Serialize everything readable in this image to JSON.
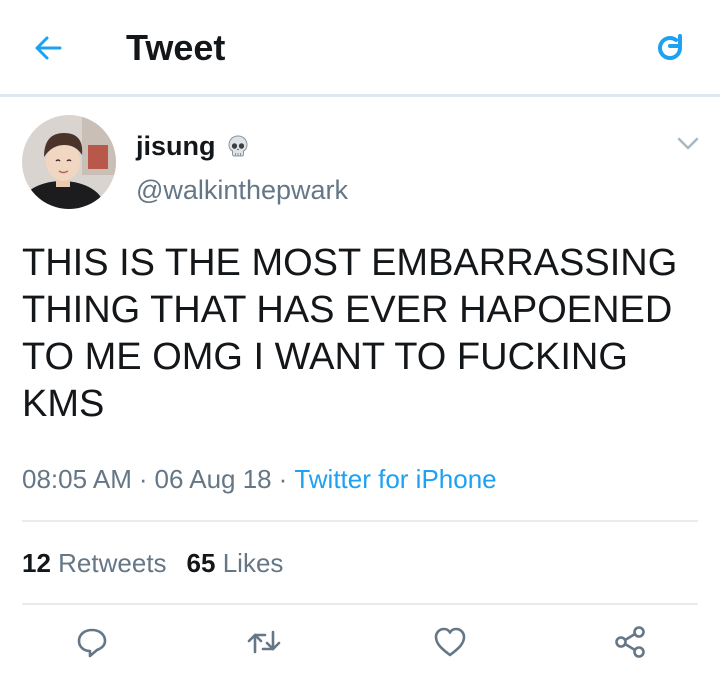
{
  "header": {
    "back_icon": "arrow-left-icon",
    "title": "Tweet",
    "refresh_icon": "refresh-icon",
    "accent_color": "#1da1f2"
  },
  "tweet": {
    "display_name": "jisung",
    "display_name_emoji": "skull-icon",
    "username": "@walkinthepwark",
    "text": "THIS IS THE MOST EMBARRASSING THING THAT HAS EVER HAPOENED TO ME OMG I WANT TO FUCKING KMS",
    "time": "08:05 AM",
    "separator": "·",
    "date": "06 Aug 18",
    "source": "Twitter for iPhone",
    "retweets_count": "12",
    "retweets_label": "Retweets",
    "likes_count": "65",
    "likes_label": "Likes"
  },
  "actions": [
    {
      "icon": "reply-icon"
    },
    {
      "icon": "retweet-icon"
    },
    {
      "icon": "like-heart-icon"
    },
    {
      "icon": "share-icon"
    }
  ]
}
